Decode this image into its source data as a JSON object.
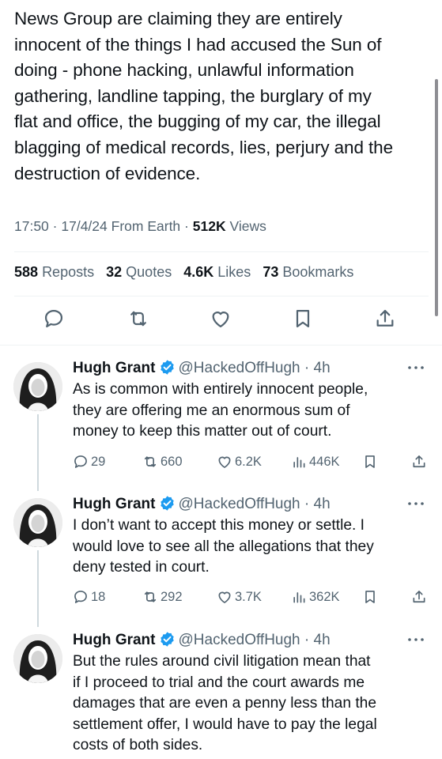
{
  "main_tweet": {
    "text": "News Group are claiming they are entirely\ninnocent of the things I had accused the Sun of\ndoing - phone hacking, unlawful information\ngathering, landline tapping, the burglary of my\nflat and office, the bugging of my car, the illegal\nblagging of medical records, lies, perjury and the\ndestruction of evidence.",
    "time": "17:50",
    "date": "17/4/24",
    "source": "From Earth",
    "views_count": "512K",
    "views_label": "Views",
    "reposts_count": "588",
    "reposts_label": "Reposts",
    "quotes_count": "32",
    "quotes_label": "Quotes",
    "likes_count": "4.6K",
    "likes_label": "Likes",
    "bookmarks_count": "73",
    "bookmarks_label": "Bookmarks"
  },
  "replies": [
    {
      "name": "Hugh Grant",
      "handle": "@HackedOffHugh",
      "time": "4h",
      "text": "As is common with entirely innocent people,\nthey are offering me an enormous sum of\nmoney to keep this matter out of court.",
      "replies": "29",
      "reposts": "660",
      "likes": "6.2K",
      "views": "446K"
    },
    {
      "name": "Hugh Grant",
      "handle": "@HackedOffHugh",
      "time": "4h",
      "text": "I don’t want to accept this money or settle. I\nwould love to see all the allegations that they\ndeny tested in court.",
      "replies": "18",
      "reposts": "292",
      "likes": "3.7K",
      "views": "362K"
    },
    {
      "name": "Hugh Grant",
      "handle": "@HackedOffHugh",
      "time": "4h",
      "text": "But the rules around civil litigation mean that\nif I proceed to trial and the court  awards me\ndamages that are even a penny less than the\nsettlement offer, I would have to pay the legal\ncosts of both sides."
    }
  ],
  "colors": {
    "text": "#0f1419",
    "secondary": "#536471",
    "verified": "#1d9bf0",
    "divider": "#eff3f4"
  },
  "icons": [
    "reply-icon",
    "repost-icon",
    "like-icon",
    "bookmark-icon",
    "share-icon",
    "views-icon",
    "verified-icon",
    "more-icon"
  ]
}
